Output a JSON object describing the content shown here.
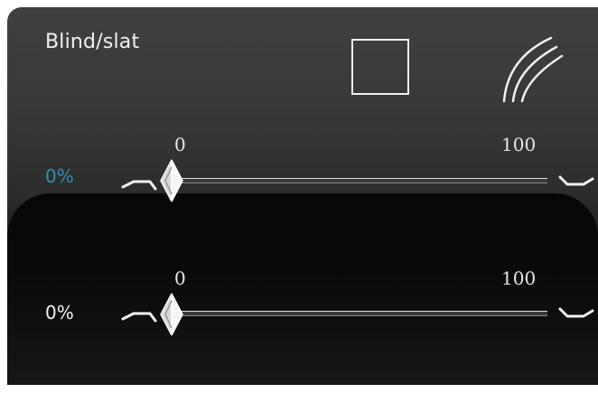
{
  "panel": {
    "title": "Blind/slat",
    "icons": {
      "position_icon": "square-icon",
      "slat_icon": "arc-icon"
    }
  },
  "sliders": [
    {
      "name": "blind-position",
      "value_label": "0%",
      "value": 0,
      "min_label": "0",
      "max_label": "100",
      "value_color": "#2f8fb3"
    },
    {
      "name": "slat-angle",
      "value_label": "0%",
      "value": 0,
      "min_label": "0",
      "max_label": "100",
      "value_color": "#f2f2f2"
    }
  ]
}
